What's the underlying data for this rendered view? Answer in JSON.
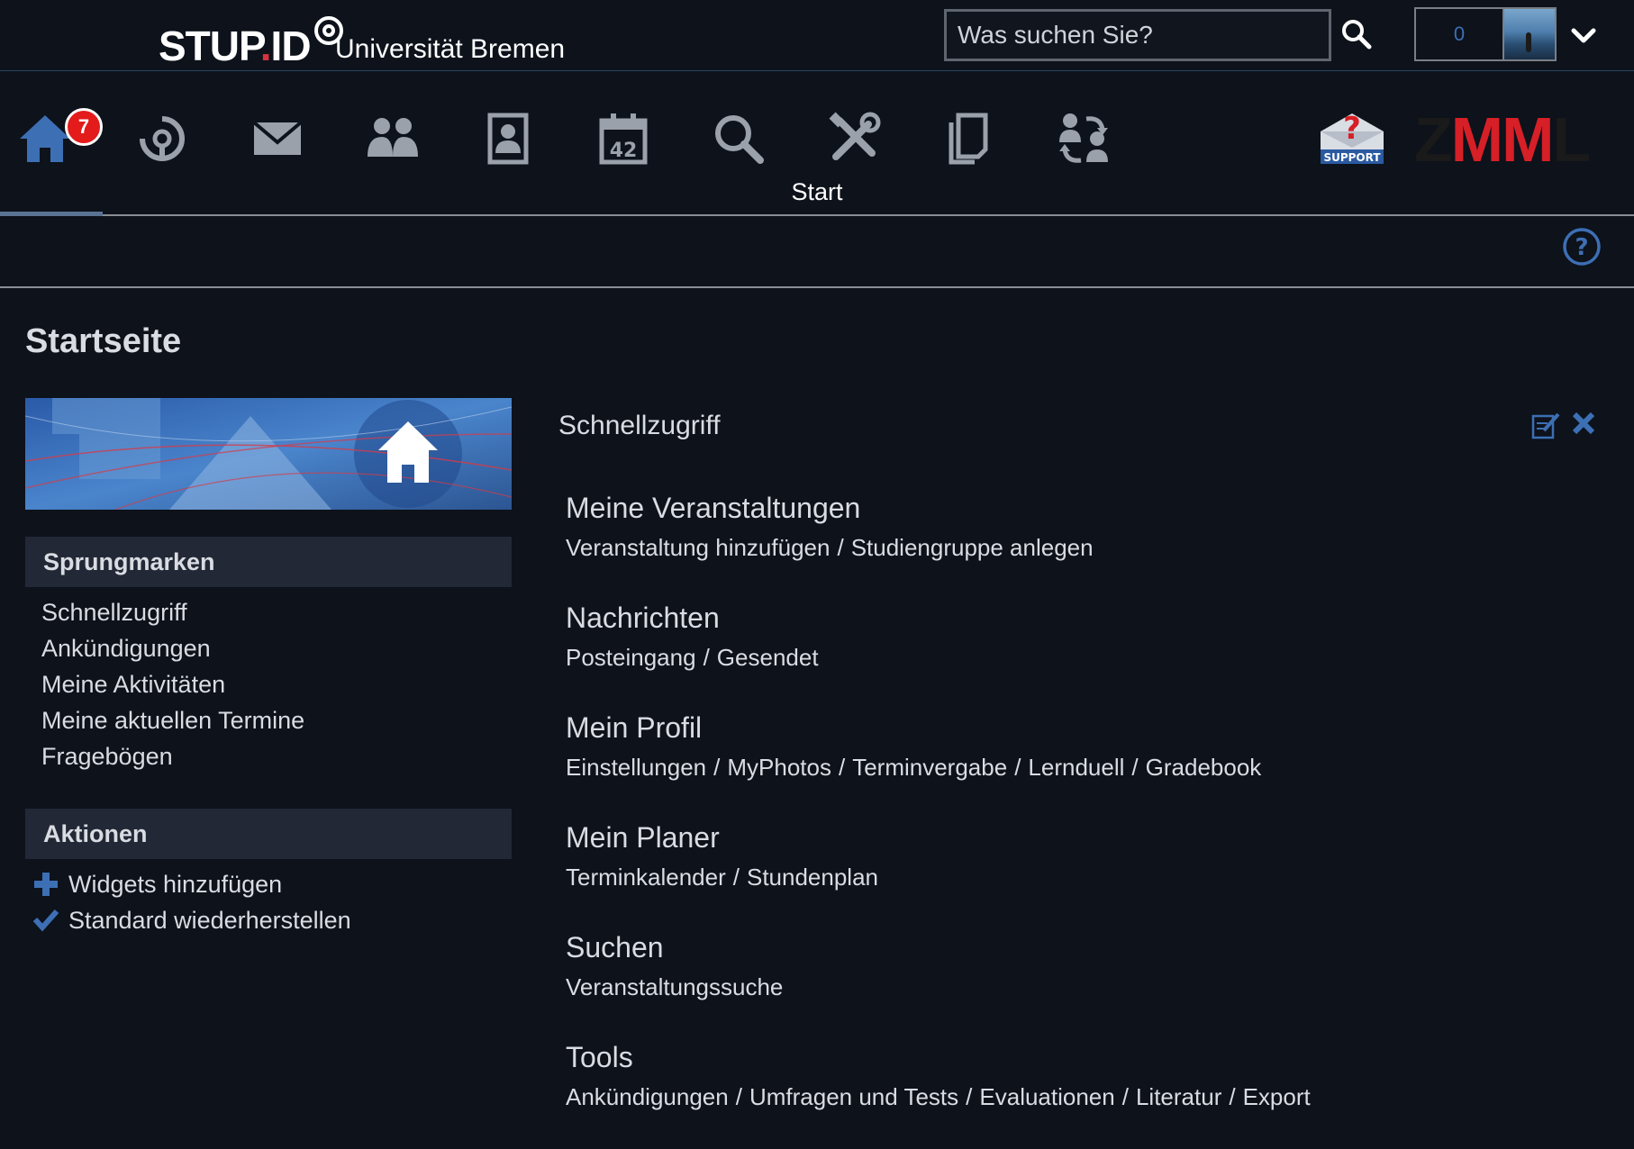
{
  "header": {
    "logo_text_1": "STUP",
    "logo_dot": ".",
    "logo_text_2": "ID",
    "university": "Universität Bremen",
    "search_placeholder": "Was suchen Sie?",
    "notification_count": "0"
  },
  "nav": {
    "start_label": "Start",
    "start_badge": "7",
    "items": [
      "profile-circle-icon",
      "mail-icon",
      "community-icon",
      "contacts-icon",
      "calendar-icon",
      "search-icon",
      "tools-icon",
      "files-icon",
      "admission-icon"
    ],
    "support_label": "SUPPORT",
    "zmml": {
      "z": "Z",
      "mm": "MM",
      "l": "L"
    }
  },
  "page_title": "Startseite",
  "sidebar": {
    "sprungmarken_head": "Sprungmarken",
    "sprungmarken": [
      "Schnellzugriff",
      "Ankündigungen",
      "Meine Aktivitäten",
      "Meine aktuellen Termine",
      "Fragebögen"
    ],
    "aktionen_head": "Aktionen",
    "aktionen": [
      "Widgets hinzufügen",
      "Standard wiederherstellen"
    ]
  },
  "widget": {
    "title": "Schnellzugriff",
    "sections": [
      {
        "title": "Meine Veranstaltungen",
        "links": [
          "Veranstaltung hinzufügen",
          "Studiengruppe anlegen"
        ]
      },
      {
        "title": "Nachrichten",
        "links": [
          "Posteingang",
          "Gesendet"
        ]
      },
      {
        "title": "Mein Profil",
        "links": [
          "Einstellungen",
          "MyPhotos",
          "Terminvergabe",
          "Lernduell",
          "Gradebook"
        ]
      },
      {
        "title": "Mein Planer",
        "links": [
          "Terminkalender",
          "Stundenplan"
        ]
      },
      {
        "title": "Suchen",
        "links": [
          "Veranstaltungssuche"
        ]
      },
      {
        "title": "Tools",
        "links": [
          "Ankündigungen",
          "Umfragen und Tests",
          "Evaluationen",
          "Literatur",
          "Export"
        ]
      }
    ]
  },
  "colors": {
    "background": "#0d121b",
    "accent_blue": "#3d6fb4",
    "badge_red": "#e31b1b",
    "nav_icon": "#9aa1ab"
  }
}
